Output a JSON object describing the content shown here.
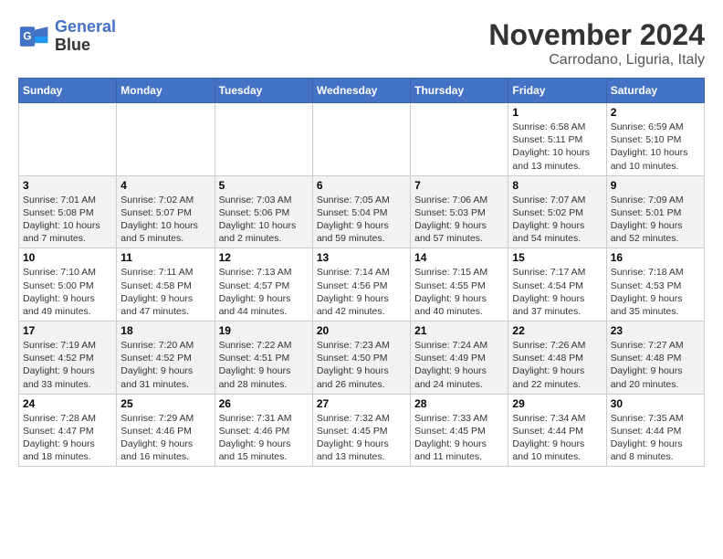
{
  "header": {
    "logo_line1": "General",
    "logo_line2": "Blue",
    "month": "November 2024",
    "location": "Carrodano, Liguria, Italy"
  },
  "weekdays": [
    "Sunday",
    "Monday",
    "Tuesday",
    "Wednesday",
    "Thursday",
    "Friday",
    "Saturday"
  ],
  "weeks": [
    [
      {
        "day": "",
        "info": ""
      },
      {
        "day": "",
        "info": ""
      },
      {
        "day": "",
        "info": ""
      },
      {
        "day": "",
        "info": ""
      },
      {
        "day": "",
        "info": ""
      },
      {
        "day": "1",
        "info": "Sunrise: 6:58 AM\nSunset: 5:11 PM\nDaylight: 10 hours and 13 minutes."
      },
      {
        "day": "2",
        "info": "Sunrise: 6:59 AM\nSunset: 5:10 PM\nDaylight: 10 hours and 10 minutes."
      }
    ],
    [
      {
        "day": "3",
        "info": "Sunrise: 7:01 AM\nSunset: 5:08 PM\nDaylight: 10 hours and 7 minutes."
      },
      {
        "day": "4",
        "info": "Sunrise: 7:02 AM\nSunset: 5:07 PM\nDaylight: 10 hours and 5 minutes."
      },
      {
        "day": "5",
        "info": "Sunrise: 7:03 AM\nSunset: 5:06 PM\nDaylight: 10 hours and 2 minutes."
      },
      {
        "day": "6",
        "info": "Sunrise: 7:05 AM\nSunset: 5:04 PM\nDaylight: 9 hours and 59 minutes."
      },
      {
        "day": "7",
        "info": "Sunrise: 7:06 AM\nSunset: 5:03 PM\nDaylight: 9 hours and 57 minutes."
      },
      {
        "day": "8",
        "info": "Sunrise: 7:07 AM\nSunset: 5:02 PM\nDaylight: 9 hours and 54 minutes."
      },
      {
        "day": "9",
        "info": "Sunrise: 7:09 AM\nSunset: 5:01 PM\nDaylight: 9 hours and 52 minutes."
      }
    ],
    [
      {
        "day": "10",
        "info": "Sunrise: 7:10 AM\nSunset: 5:00 PM\nDaylight: 9 hours and 49 minutes."
      },
      {
        "day": "11",
        "info": "Sunrise: 7:11 AM\nSunset: 4:58 PM\nDaylight: 9 hours and 47 minutes."
      },
      {
        "day": "12",
        "info": "Sunrise: 7:13 AM\nSunset: 4:57 PM\nDaylight: 9 hours and 44 minutes."
      },
      {
        "day": "13",
        "info": "Sunrise: 7:14 AM\nSunset: 4:56 PM\nDaylight: 9 hours and 42 minutes."
      },
      {
        "day": "14",
        "info": "Sunrise: 7:15 AM\nSunset: 4:55 PM\nDaylight: 9 hours and 40 minutes."
      },
      {
        "day": "15",
        "info": "Sunrise: 7:17 AM\nSunset: 4:54 PM\nDaylight: 9 hours and 37 minutes."
      },
      {
        "day": "16",
        "info": "Sunrise: 7:18 AM\nSunset: 4:53 PM\nDaylight: 9 hours and 35 minutes."
      }
    ],
    [
      {
        "day": "17",
        "info": "Sunrise: 7:19 AM\nSunset: 4:52 PM\nDaylight: 9 hours and 33 minutes."
      },
      {
        "day": "18",
        "info": "Sunrise: 7:20 AM\nSunset: 4:52 PM\nDaylight: 9 hours and 31 minutes."
      },
      {
        "day": "19",
        "info": "Sunrise: 7:22 AM\nSunset: 4:51 PM\nDaylight: 9 hours and 28 minutes."
      },
      {
        "day": "20",
        "info": "Sunrise: 7:23 AM\nSunset: 4:50 PM\nDaylight: 9 hours and 26 minutes."
      },
      {
        "day": "21",
        "info": "Sunrise: 7:24 AM\nSunset: 4:49 PM\nDaylight: 9 hours and 24 minutes."
      },
      {
        "day": "22",
        "info": "Sunrise: 7:26 AM\nSunset: 4:48 PM\nDaylight: 9 hours and 22 minutes."
      },
      {
        "day": "23",
        "info": "Sunrise: 7:27 AM\nSunset: 4:48 PM\nDaylight: 9 hours and 20 minutes."
      }
    ],
    [
      {
        "day": "24",
        "info": "Sunrise: 7:28 AM\nSunset: 4:47 PM\nDaylight: 9 hours and 18 minutes."
      },
      {
        "day": "25",
        "info": "Sunrise: 7:29 AM\nSunset: 4:46 PM\nDaylight: 9 hours and 16 minutes."
      },
      {
        "day": "26",
        "info": "Sunrise: 7:31 AM\nSunset: 4:46 PM\nDaylight: 9 hours and 15 minutes."
      },
      {
        "day": "27",
        "info": "Sunrise: 7:32 AM\nSunset: 4:45 PM\nDaylight: 9 hours and 13 minutes."
      },
      {
        "day": "28",
        "info": "Sunrise: 7:33 AM\nSunset: 4:45 PM\nDaylight: 9 hours and 11 minutes."
      },
      {
        "day": "29",
        "info": "Sunrise: 7:34 AM\nSunset: 4:44 PM\nDaylight: 9 hours and 10 minutes."
      },
      {
        "day": "30",
        "info": "Sunrise: 7:35 AM\nSunset: 4:44 PM\nDaylight: 9 hours and 8 minutes."
      }
    ]
  ]
}
